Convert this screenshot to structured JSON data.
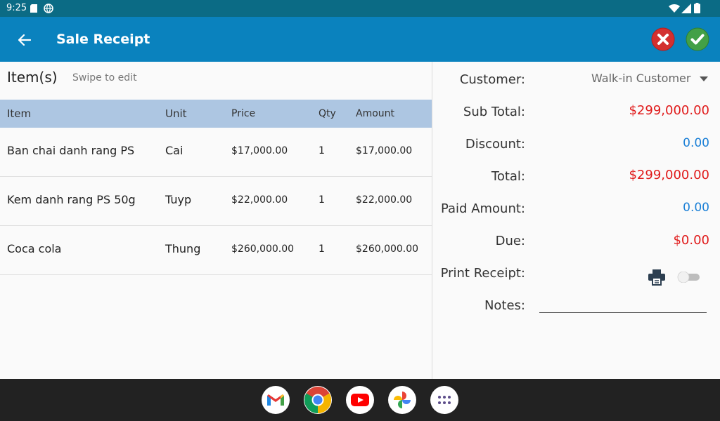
{
  "status_bar": {
    "time": "9:25"
  },
  "app_bar": {
    "title": "Sale Receipt"
  },
  "items_panel": {
    "heading": "Item(s)",
    "hint": "Swipe to edit",
    "columns": {
      "item": "Item",
      "unit": "Unit",
      "price": "Price",
      "qty": "Qty",
      "amount": "Amount"
    },
    "rows": [
      {
        "item": "Ban chai danh rang PS",
        "unit": "Cai",
        "price": "$17,000.00",
        "qty": "1",
        "amount": "$17,000.00"
      },
      {
        "item": "Kem danh rang PS 50g",
        "unit": "Tuyp",
        "price": "$22,000.00",
        "qty": "1",
        "amount": "$22,000.00"
      },
      {
        "item": "Coca cola",
        "unit": "Thung",
        "price": "$260,000.00",
        "qty": "1",
        "amount": "$260,000.00"
      }
    ]
  },
  "summary": {
    "customer_label": "Customer:",
    "customer_value": "Walk-in Customer",
    "subtotal_label": "Sub Total:",
    "subtotal_value": "$299,000.00",
    "discount_label": "Discount:",
    "discount_value": "0.00",
    "total_label": "Total:",
    "total_value": "$299,000.00",
    "paid_label": "Paid Amount:",
    "paid_value": "0.00",
    "due_label": "Due:",
    "due_value": "$0.00",
    "print_label": "Print Receipt:",
    "print_enabled": false,
    "notes_label": "Notes:",
    "notes_value": ""
  },
  "colors": {
    "status_bar": "#0b6b85",
    "app_bar": "#0a82be",
    "table_header": "#adc6e2",
    "red": "#e01a1a",
    "blue": "#1a7fd6",
    "cancel": "#d32f2f",
    "confirm": "#43a047"
  },
  "icons": {
    "back": "arrow-left-icon",
    "cancel": "close-circle-icon",
    "confirm": "check-circle-icon",
    "dropdown": "caret-down-icon",
    "printer": "printer-icon",
    "dock": [
      "gmail-icon",
      "chrome-icon",
      "youtube-icon",
      "photos-icon",
      "app-drawer-icon"
    ]
  }
}
